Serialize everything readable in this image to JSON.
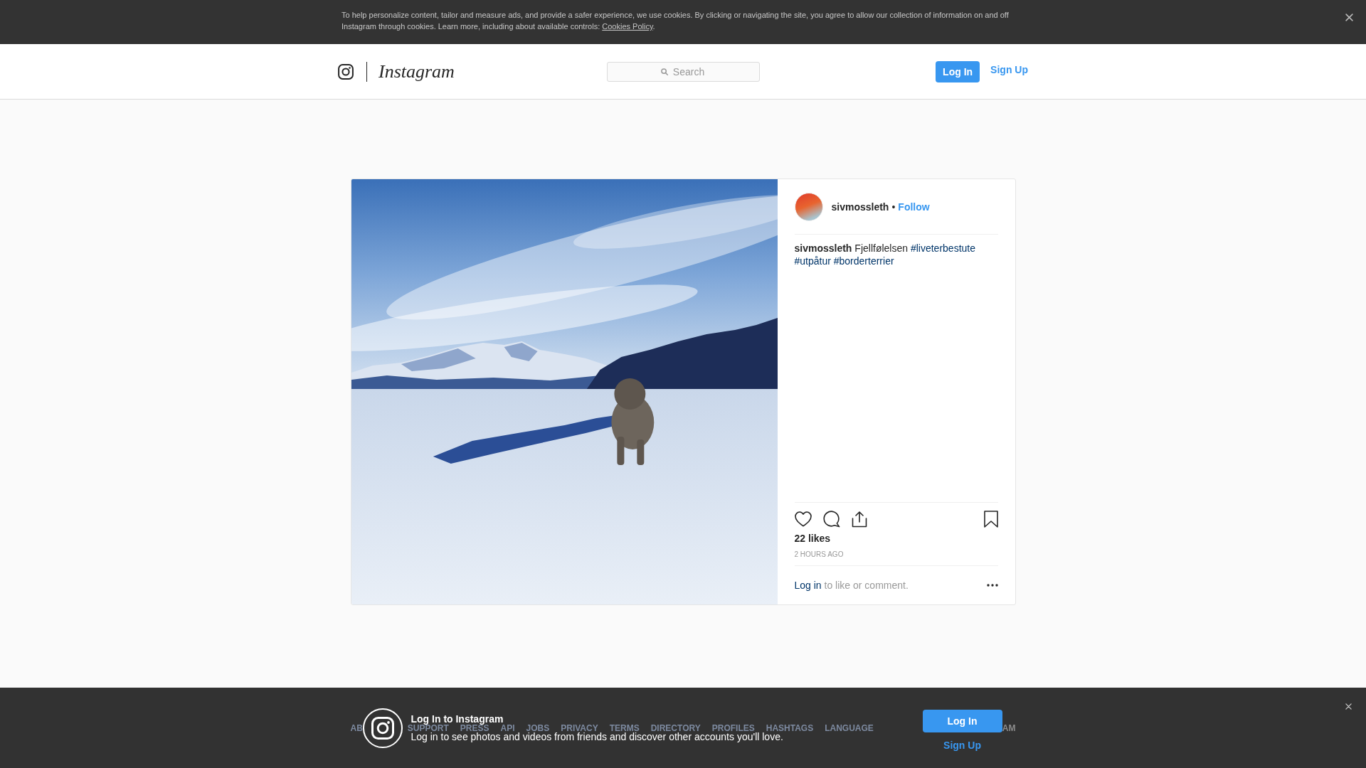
{
  "cookie_banner": {
    "text": "To help personalize content, tailor and measure ads, and provide a safer experience, we use cookies. By clicking or navigating the site, you agree to allow our collection of information on and off Instagram through cookies. Learn more, including about available controls:",
    "link": "Cookies Policy",
    "end": "."
  },
  "header": {
    "logo": "Instagram",
    "search": {
      "placeholder": "Search"
    },
    "buttons": [
      {
        "label": "Log In",
        "kind": "primary"
      },
      {
        "label": "Sign Up",
        "kind": "link"
      }
    ]
  },
  "post": {
    "author": "sivmossleth",
    "separator": "•",
    "follow": "Follow",
    "caption": {
      "author": "sivmossleth",
      "text": "Fjellfølelsen",
      "hashtags": [
        "#liveterbestute",
        "#utpåtur",
        "#borderterrier"
      ]
    },
    "likes": "22 likes",
    "time": "2 HOURS AGO",
    "comment_prompt": {
      "link": "Log in",
      "text": "to like or comment."
    }
  },
  "footer": {
    "links": [
      "AB",
      "SUPPORT",
      "PRESS",
      "API",
      "JOBS",
      "PRIVACY",
      "TERMS",
      "DIRECTORY",
      "PROFILES",
      "HASHTAGS",
      "LANGUAGE"
    ],
    "copyright": "AM"
  },
  "login_banner": {
    "title": "Log In to Instagram",
    "text": "Log in to see photos and videos from friends and discover other accounts you'll love.",
    "buttons": [
      {
        "label": "Log In",
        "kind": "primary"
      },
      {
        "label": "Sign Up",
        "kind": "link"
      }
    ]
  }
}
